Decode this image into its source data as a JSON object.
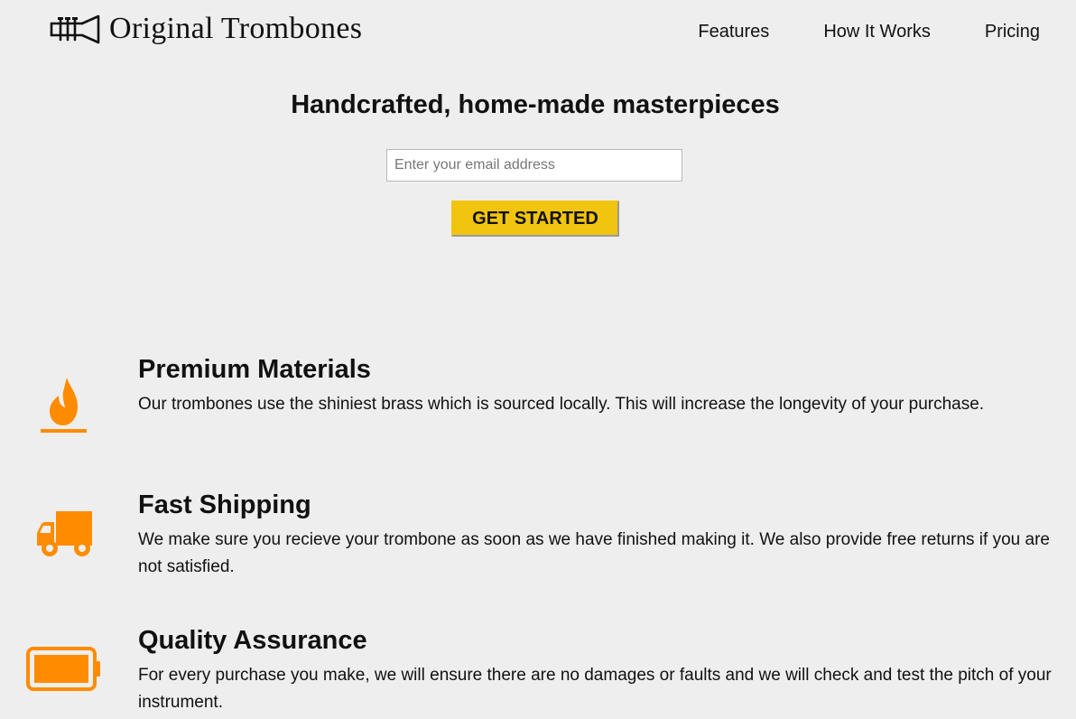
{
  "brand": {
    "name": "Original Trombones",
    "logo_icon": "trombone-logo-icon"
  },
  "nav": {
    "items": [
      {
        "label": "Features"
      },
      {
        "label": "How It Works"
      },
      {
        "label": "Pricing"
      }
    ]
  },
  "hero": {
    "title": "Handcrafted, home-made masterpieces",
    "email_placeholder": "Enter your email address",
    "email_value": "",
    "cta_label": "GET STARTED"
  },
  "features": [
    {
      "icon": "fire-icon",
      "title": "Premium Materials",
      "description": "Our trombones use the shiniest brass which is sourced locally. This will increase the longevity of your purchase."
    },
    {
      "icon": "truck-icon",
      "title": "Fast Shipping",
      "description": "We make sure you recieve your trombone as soon as we have finished making it. We also provide free returns if you are not satisfied."
    },
    {
      "icon": "battery-icon",
      "title": "Quality Assurance",
      "description": "For every purchase you make, we will ensure there are no damages or faults and we will check and test the pitch of your instrument."
    }
  ],
  "colors": {
    "background": "#eeeeee",
    "accent": "#f1c40f",
    "icon": "#ff8c00",
    "text": "#111111"
  }
}
